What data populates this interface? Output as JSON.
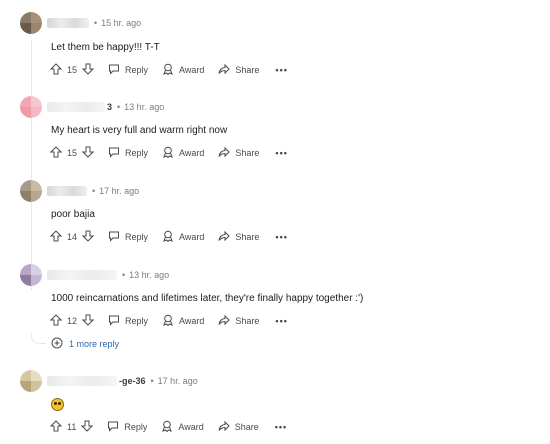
{
  "comments": [
    {
      "timestamp": "15 hr. ago",
      "text": "Let them be happy!!! T-T",
      "votes": "15",
      "name_tail": ""
    },
    {
      "timestamp": "13 hr. ago",
      "text": "My heart is very full and warm right now",
      "votes": "15",
      "name_tail": "3"
    },
    {
      "timestamp": "17 hr. ago",
      "text": "poor bajia",
      "votes": "14",
      "name_tail": ""
    },
    {
      "timestamp": "13 hr. ago",
      "text": "1000 reincarnations and lifetimes later, they're finally happy together :')",
      "votes": "12",
      "name_tail": ""
    },
    {
      "timestamp": "17 hr. ago",
      "text": "",
      "votes": "11",
      "name_tail": "-ge-36"
    }
  ],
  "actions": {
    "reply": "Reply",
    "award": "Award",
    "share": "Share",
    "more": "•••"
  },
  "more_replies": "1 more reply",
  "separator": "•",
  "icons": [
    "upvote-icon",
    "downvote-icon",
    "reply-icon",
    "award-icon",
    "share-icon",
    "plus-circle-icon",
    "emoji-icon"
  ],
  "colors": {
    "link": "#2a6aa8",
    "muted": "#7c7c7c",
    "thread_line": "#e5e7ea"
  }
}
